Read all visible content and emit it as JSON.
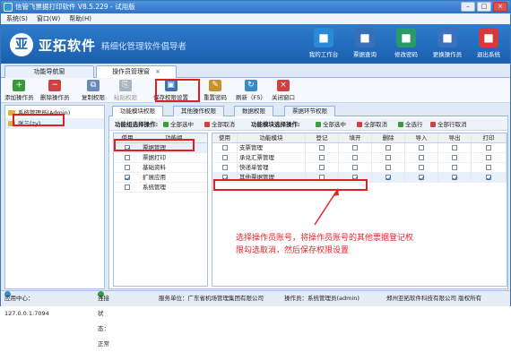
{
  "window": {
    "title": "信管飞票据打印软件 V8.5.229 - 试用版",
    "min": "–",
    "max": "□",
    "close": "×"
  },
  "menu": [
    "系统(S)",
    "窗口(W)",
    "帮助(H)"
  ],
  "banner": {
    "logo_glyph": "亚",
    "brand": "亚拓软件",
    "slogan": "精细化管理软件倡导者",
    "nav": [
      {
        "label": "我的工作台",
        "icon": "monitor-icon",
        "color": "#2a8ad8"
      },
      {
        "label": "票据查询",
        "icon": "search-doc-icon",
        "color": "#3a6fb8"
      },
      {
        "label": "修改密码",
        "icon": "key-icon",
        "color": "#2a9a6a"
      },
      {
        "label": "更换操作员",
        "icon": "user-switch-icon",
        "color": "#3a72c0"
      },
      {
        "label": "退出系统",
        "icon": "power-icon",
        "color": "#d63b3b"
      }
    ]
  },
  "main_tabs": [
    {
      "label": "功能导航窗"
    },
    {
      "label": "操作员管理窗",
      "close": "×"
    }
  ],
  "toolbar": [
    {
      "label": "添加操作员",
      "color": "#3a9a3a",
      "glyph": "+",
      "disabled": false
    },
    {
      "label": "删除操作员",
      "color": "#d04040",
      "glyph": "−",
      "disabled": false
    },
    {
      "label": "复制权限",
      "color": "#6a8ab8",
      "glyph": "⧉",
      "disabled": false
    },
    {
      "label": "粘贴权限",
      "color": "#a8b4c4",
      "glyph": "⎘",
      "disabled": true
    },
    {
      "label": "保存权限设置",
      "color": "#3a6fb8",
      "glyph": "▣",
      "disabled": false
    },
    {
      "label": "重置密码",
      "color": "#c8912a",
      "glyph": "✎",
      "disabled": false
    },
    {
      "label": "刷新（F5）",
      "color": "#3a8ac8",
      "glyph": "↻",
      "disabled": false
    },
    {
      "label": "关闭窗口",
      "color": "#d04040",
      "glyph": "×",
      "disabled": false
    }
  ],
  "operators": [
    "系统管理员(Admin)",
    "张三(zy)"
  ],
  "sub_tabs": [
    "功能模块权限",
    "其他操作权限",
    "数据权限",
    "票据环节权限"
  ],
  "ops_left": {
    "label": "功能组选择操作:",
    "select_all": "全部选中",
    "cancel_all": "全部取消"
  },
  "ops_right": {
    "label": "功能模块选择操作:",
    "select_all": "全部选中",
    "cancel_all": "全部取消",
    "select_row": "全选行",
    "cancel_row": "全部行取消"
  },
  "group_table": {
    "headers": [
      "使用",
      "功能组"
    ],
    "rows": [
      {
        "name": "票据管理",
        "checked": true
      },
      {
        "name": "票据打印",
        "checked": false
      },
      {
        "name": "基础资料",
        "checked": false
      },
      {
        "name": "扩展应用",
        "checked": true
      },
      {
        "name": "系统管理",
        "checked": false
      }
    ]
  },
  "module_table": {
    "headers": [
      "使用",
      "功能模块",
      "登记",
      "填开",
      "删除",
      "导入",
      "导出",
      "打印"
    ],
    "rows": [
      {
        "name": "支票管理",
        "cells": [
          false,
          false,
          false,
          false,
          false,
          false,
          false
        ]
      },
      {
        "name": "承兑汇票管理",
        "cells": [
          false,
          false,
          false,
          false,
          false,
          false,
          false
        ]
      },
      {
        "name": "快递单管理",
        "cells": [
          false,
          false,
          false,
          false,
          false,
          false,
          false
        ]
      },
      {
        "name": "其他票据管理",
        "cells": [
          true,
          false,
          true,
          true,
          true,
          true,
          true
        ]
      }
    ]
  },
  "annotation": "选择操作员账号，将操作员账号的其他票据登记权限勾选取消，然后保存权限设置",
  "status": {
    "app_center": "应用中心：127.0.0.1:7094",
    "connection": "连接状态：正常",
    "unit": "服务单位：广东省机场管理集团有限公司",
    "operator": "操作员：系统管理员(admin)",
    "copyright": "郑州亚拓软件科技有限公司  版权所有"
  }
}
